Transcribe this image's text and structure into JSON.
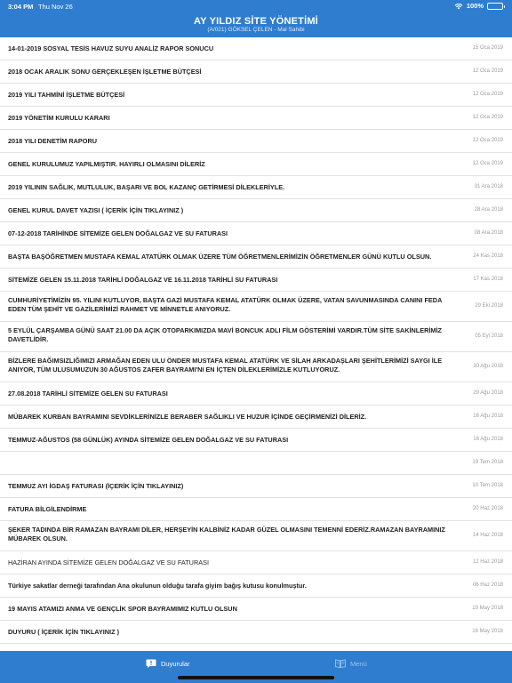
{
  "status": {
    "time": "3:04 PM",
    "date": "Thu Nov 26",
    "battery": "100%",
    "battery_level": 1.0
  },
  "header": {
    "title": "AY YILDIZ SİTE YÖNETİMİ",
    "subtitle": "(A/021) GÖKSEL ÇELEN - Mal Sahibi"
  },
  "announcements": [
    {
      "text": "14-01-2019 SOSYAL TESİS HAVUZ SUYU ANALİZ RAPOR SONUCU",
      "date": "15 Oca 2019"
    },
    {
      "text": "2018 OCAK ARALIK SONU GERÇEKLEŞEN İŞLETME BÜTÇESİ",
      "date": "12 Oca 2019"
    },
    {
      "text": "2019 YILI TAHMİNİ İŞLETME BÜTÇESİ",
      "date": "12 Oca 2019"
    },
    {
      "text": "2019 YÖNETİM KURULU KARARI",
      "date": "12 Oca 2019"
    },
    {
      "text": "2018 YILI DENETİM RAPORU",
      "date": "12 Oca 2019"
    },
    {
      "text": "GENEL KURULUMUZ YAPILMIŞTIR. HAYIRLI OLMASINI DİLERİZ",
      "date": "12 Oca 2019"
    },
    {
      "text": "2019 YILININ SAĞLIK, MUTLULUK, BAŞARI VE BOL KAZANÇ GETİRMESİ DİLEKLERİYLE.",
      "date": "31 Ara 2018"
    },
    {
      "text": "GENEL KURUL DAVET YAZISI ( İÇERİK İÇİN TIKLAYINIZ )",
      "date": "28 Ara 2018"
    },
    {
      "text": "07-12-2018 TARİHİNDE SİTEMİZE GELEN DOĞALGAZ VE SU FATURASI",
      "date": "08 Ara 2018"
    },
    {
      "text": "BAŞTA BAŞÖĞRETMEN MUSTAFA KEMAL ATATÜRK OLMAK ÜZERE TÜM ÖĞRETMENLERİMİZİN ÖĞRETMENLER GÜNÜ KUTLU OLSUN.",
      "date": "24 Kas 2018"
    },
    {
      "text": "SİTEMİZE GELEN 15.11.2018 TARİHLİ DOĞALGAZ VE 16.11.2018 TARİHLİ SU FATURASI",
      "date": "17 Kas 2018"
    },
    {
      "text": "CUMHURİYETİMİZİN 95. YILINI KUTLUYOR, BAŞTA GAZİ MUSTAFA KEMAL ATATÜRK OLMAK ÜZERE, VATAN SAVUNMASINDA CANINI FEDA EDEN TÜM ŞEHİT VE GAZİLERİMİZİ RAHMET VE MİNNETLE ANIYORUZ.",
      "date": "29 Eki 2018"
    },
    {
      "text": "5 EYLÜL ÇARŞAMBA GÜNÜ SAAT 21.00 DA AÇIK OTOPARKIMIZDA MAVİ BONCUK ADLI FİLM GÖSTERİMİ VARDIR.TÜM SİTE SAKİNLERİMİZ DAVETLİDİR.",
      "date": "05 Eyl 2018"
    },
    {
      "text": "BİZLERE BAĞIMSIZLIĞIMIZI ARMAĞAN EDEN ULU ÖNDER MUSTAFA KEMAL ATATÜRK VE SİLAH ARKADAŞLARI ŞEHİTLERİMİZİ SAYGI İLE ANIYOR, TÜM ULUSUMUZUN 30 AĞUSTOS ZAFER BAYRAMI'NI EN İÇTEN DİLEKLERİMİZLE KUTLUYORUZ.",
      "date": "30 Ağu 2018"
    },
    {
      "text": "27.08.2018 TARİHLİ SİTEMİZE GELEN SU FATURASI",
      "date": "29 Ağu 2018"
    },
    {
      "text": "MÜBAREK KURBAN BAYRAMINI SEVDİKLERİNİZLE BERABER SAĞLIKLI VE HUZUR İÇİNDE GEÇİRMENİZİ DİLERİZ.",
      "date": "16 Ağu 2018"
    },
    {
      "text": "TEMMUZ-AĞUSTOS (58 GÜNLÜK) AYINDA SİTEMİZE GELEN DOĞALGAZ VE SU FATURASI",
      "date": "16 Ağu 2018"
    },
    {
      "text": "",
      "date": "19 Tem 2018"
    },
    {
      "text": "TEMMUZ AYI İGDAŞ FATURASI (İÇERİK İÇİN TIKLAYINIZ)",
      "date": "10 Tem 2018"
    },
    {
      "text": "FATURA BİLGİLENDİRME",
      "date": "20 Haz 2018"
    },
    {
      "text": "ŞEKER TADINDA BİR RAMAZAN BAYRAMI DİLER, HERŞEYİN KALBİNİZ KADAR GÜZEL OLMASINI TEMENNİ EDERİZ.RAMAZAN BAYRAMINIZ MÜBAREK OLSUN.",
      "date": "14 Haz 2018"
    },
    {
      "text": "HAZİRAN AYINDA SİTEMİZE GELEN DOĞALGAZ VE SU FATURASI",
      "date": "12 Haz 2018"
    },
    {
      "text": "Türkiye sakatlar derneği tarafından Ana okulunun olduğu tarafa giyim bağış kutusu konulmuştur.",
      "date": "06 Haz 2018"
    },
    {
      "text": "19 MAYIS ATAMIZI ANMA VE GENÇLİK SPOR BAYRAMIMIZ KUTLU OLSUN",
      "date": "19 May 2018"
    },
    {
      "text": "DUYURU ( İÇERİK İÇİN TIKLAYINIZ )",
      "date": "16 May 2018"
    }
  ],
  "tabs": {
    "announcements": "Duyurular",
    "menu": "Menü"
  }
}
